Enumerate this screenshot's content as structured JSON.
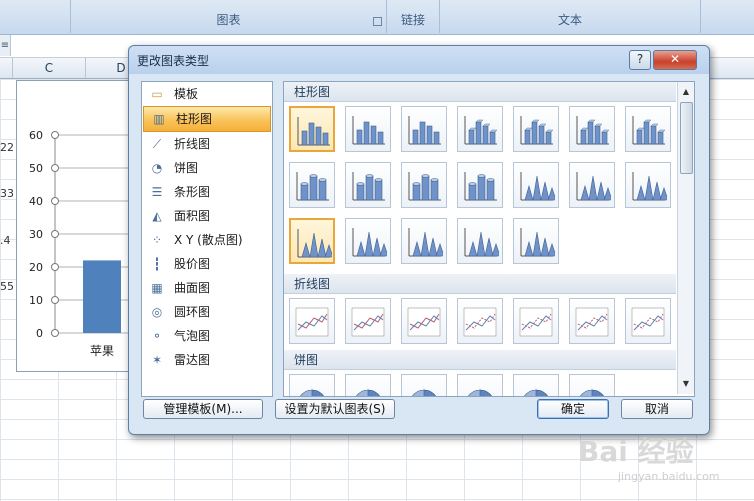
{
  "ribbon": {
    "groups": [
      {
        "label": "图表"
      },
      {
        "label": "链接"
      },
      {
        "label": "文本"
      }
    ]
  },
  "sheet": {
    "columns": [
      "C",
      "D"
    ],
    "row_values": [
      "22",
      "33",
      ".4",
      "55"
    ],
    "chart": {
      "y_ticks": [
        "60",
        "50",
        "40",
        "30",
        "20",
        "10",
        "0"
      ],
      "category": "苹果"
    }
  },
  "chart_data": {
    "type": "bar",
    "categories": [
      "苹果"
    ],
    "values": [
      22
    ],
    "ylim": [
      0,
      60
    ],
    "yticks": [
      0,
      10,
      20,
      30,
      40,
      50,
      60
    ],
    "grid": true,
    "color": "#4f81bd"
  },
  "dialog": {
    "title": "更改图表类型",
    "help_label": "?",
    "close_label": "✕",
    "chart_types": [
      {
        "label": "模板",
        "icon": "folder-icon"
      },
      {
        "label": "柱形图",
        "icon": "column-chart-icon",
        "selected": true
      },
      {
        "label": "折线图",
        "icon": "line-chart-icon"
      },
      {
        "label": "饼图",
        "icon": "pie-chart-icon"
      },
      {
        "label": "条形图",
        "icon": "bar-chart-icon"
      },
      {
        "label": "面积图",
        "icon": "area-chart-icon"
      },
      {
        "label": "X Y (散点图)",
        "icon": "scatter-chart-icon"
      },
      {
        "label": "股价图",
        "icon": "stock-chart-icon"
      },
      {
        "label": "曲面图",
        "icon": "surface-chart-icon"
      },
      {
        "label": "圆环图",
        "icon": "doughnut-chart-icon"
      },
      {
        "label": "气泡图",
        "icon": "bubble-chart-icon"
      },
      {
        "label": "雷达图",
        "icon": "radar-chart-icon"
      }
    ],
    "sections": [
      {
        "title": "柱形图"
      },
      {
        "title": "折线图"
      },
      {
        "title": "饼图"
      }
    ],
    "buttons": {
      "manage_templates": "管理模板(M)...",
      "set_default": "设置为默认图表(S)",
      "ok": "确定",
      "cancel": "取消"
    }
  },
  "watermark": {
    "brand": "Bai 经验",
    "url": "jingyan.baidu.com"
  }
}
